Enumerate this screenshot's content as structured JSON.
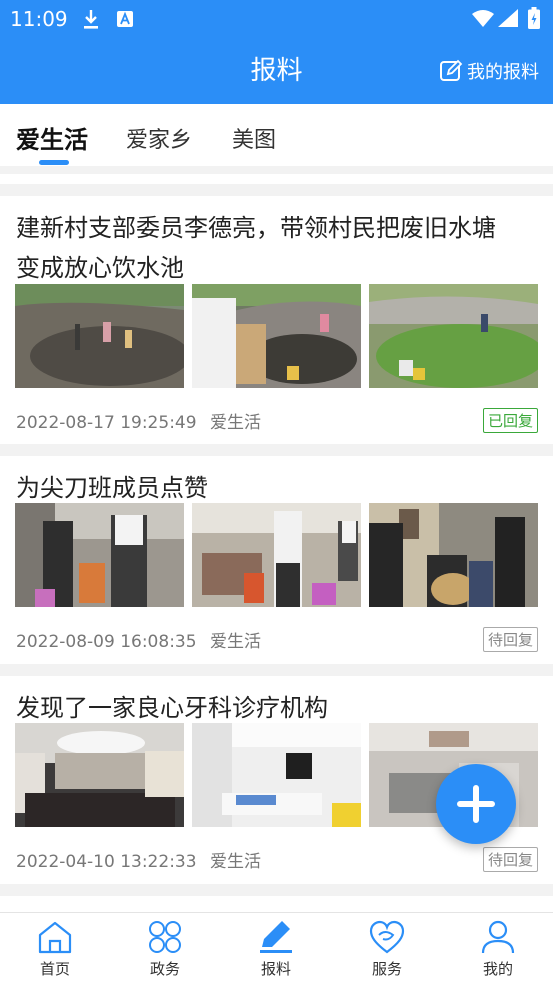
{
  "status_bar": {
    "time": "11:09"
  },
  "header": {
    "title": "报料",
    "my_report": "我的报料"
  },
  "tabs": [
    {
      "label": "爱生活",
      "active": true
    },
    {
      "label": "爱家乡",
      "active": false
    },
    {
      "label": "美图",
      "active": false
    }
  ],
  "posts": [
    {
      "title": "建新村支部委员李德亮，带领村民把废旧水塘变成放心饮水池",
      "datetime": "2022-08-17 19:25:49",
      "category": "爱生活",
      "status": "已回复",
      "status_color": "#3aa83a"
    },
    {
      "title": "为尖刀班成员点赞",
      "datetime": "2022-08-09 16:08:35",
      "category": "爱生活",
      "status": "待回复",
      "status_color": "#888888"
    },
    {
      "title": "发现了一家良心牙科诊疗机构",
      "datetime": "2022-04-10 13:22:33",
      "category": "爱生活",
      "status": "待回复",
      "status_color": "#888888"
    }
  ],
  "bottom_nav": [
    {
      "label": "首页",
      "icon": "home-icon",
      "active": false
    },
    {
      "label": "政务",
      "icon": "clover-icon",
      "active": false
    },
    {
      "label": "报料",
      "icon": "pencil-icon",
      "active": true
    },
    {
      "label": "服务",
      "icon": "heart-hand-icon",
      "active": false
    },
    {
      "label": "我的",
      "icon": "user-icon",
      "active": false
    }
  ],
  "colors": {
    "primary": "#2b8ef7",
    "replied": "#3aa83a",
    "pending": "#888888"
  }
}
